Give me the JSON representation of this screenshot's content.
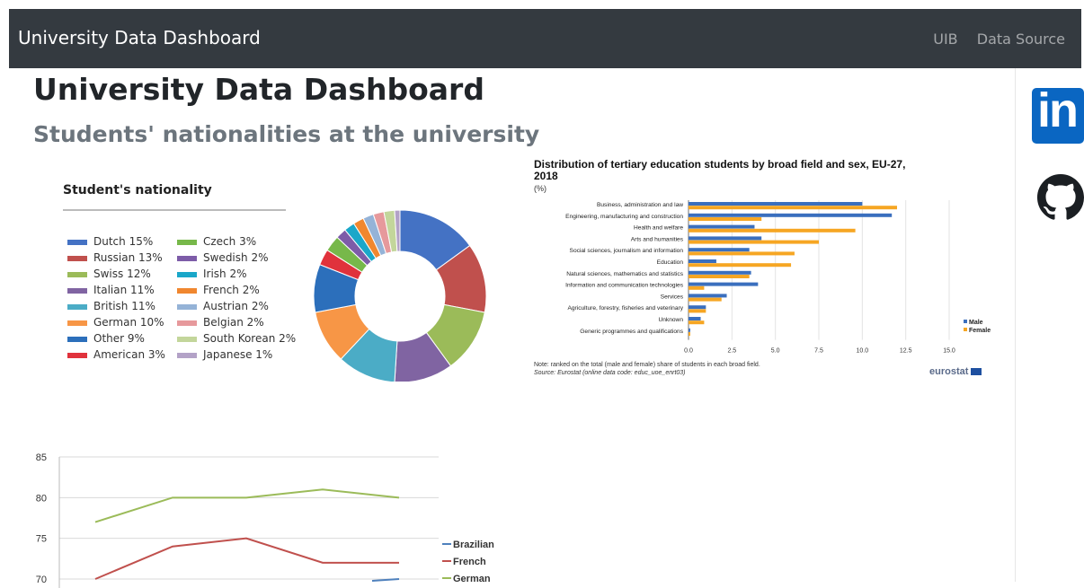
{
  "navbar": {
    "brand": "University Data Dashboard",
    "links": [
      "UIB",
      "Data Source"
    ]
  },
  "page": {
    "title": "University Data Dashboard",
    "subtitle": "Students' nationalities at the university"
  },
  "social": {
    "linkedin": "in",
    "colors": {
      "linkedin": "#0a66c2",
      "navbar": "#343a40"
    },
    "icons": [
      "linkedin-icon",
      "github-icon"
    ]
  },
  "chart_data": [
    {
      "type": "pie",
      "title": "Student's nationality",
      "donut": true,
      "slices": [
        {
          "label": "Dutch 15%",
          "value": 15,
          "color": "#4472c4"
        },
        {
          "label": "Russian 13%",
          "value": 13,
          "color": "#c0504d"
        },
        {
          "label": "Swiss 12%",
          "value": 12,
          "color": "#9bbb59"
        },
        {
          "label": "Italian 11%",
          "value": 11,
          "color": "#8064a2"
        },
        {
          "label": "British 11%",
          "value": 11,
          "color": "#4bacc6"
        },
        {
          "label": "German 10%",
          "value": 10,
          "color": "#f79646"
        },
        {
          "label": "Other 9%",
          "value": 9,
          "color": "#2c6fbb"
        },
        {
          "label": "American 3%",
          "value": 3,
          "color": "#e0323c"
        },
        {
          "label": "Czech 3%",
          "value": 3,
          "color": "#77b84a"
        },
        {
          "label": "Swedish 2%",
          "value": 2,
          "color": "#7d5ca8"
        },
        {
          "label": "Irish 2%",
          "value": 2,
          "color": "#1aa7c9"
        },
        {
          "label": "French 2%",
          "value": 2,
          "color": "#f0872f"
        },
        {
          "label": "Austrian 2%",
          "value": 2,
          "color": "#95b3d7"
        },
        {
          "label": "Belgian 2%",
          "value": 2,
          "color": "#e6999c"
        },
        {
          "label": "South Korean 2%",
          "value": 2,
          "color": "#c3d69b"
        },
        {
          "label": "Japanese 1%",
          "value": 1,
          "color": "#b3a2c7"
        }
      ]
    },
    {
      "type": "bar",
      "orientation": "horizontal",
      "title": "Distribution of tertiary education students by broad field and sex, EU-27, 2018",
      "subtitle": "(%)",
      "categories": [
        "Business, administration and law",
        "Engineering, manufacturing and construction",
        "Health and welfare",
        "Arts and humanities",
        "Social sciences, journalism and information",
        "Education",
        "Natural sciences, mathematics and statistics",
        "Information and communication technologies",
        "Services",
        "Agriculture, forestry, fisheries and veterinary",
        "Unknown",
        "Generic programmes and qualifications"
      ],
      "series": [
        {
          "name": "Male",
          "color": "#3a6fbe",
          "values": [
            10.0,
            11.7,
            3.8,
            4.2,
            3.5,
            1.6,
            3.6,
            4.0,
            2.2,
            1.0,
            0.7,
            0.1
          ]
        },
        {
          "name": "Female",
          "color": "#f6a623",
          "values": [
            12.0,
            4.2,
            9.6,
            7.5,
            6.1,
            5.9,
            3.5,
            0.9,
            1.9,
            1.0,
            0.9,
            0.1
          ]
        }
      ],
      "xlim": [
        0,
        15
      ],
      "xticks": [
        "0.0",
        "2.5",
        "5.0",
        "7.5",
        "10.0",
        "12.5",
        "15.0"
      ],
      "legend": "right",
      "note": "Note: ranked on the total (male and female) share of students in each broad field.",
      "source": "Source: Eurostat (online data code: educ_uoe_enrt03)",
      "logo": "eurostat"
    },
    {
      "type": "line",
      "yticks": [
        "85",
        "80",
        "75",
        "70"
      ],
      "ylim": [
        70,
        85
      ],
      "series": [
        {
          "name": "Brazilian",
          "color": "#4f81bd",
          "values": [
            null,
            null,
            null,
            null,
            70
          ]
        },
        {
          "name": "French",
          "color": "#c0504d",
          "values": [
            70,
            74,
            75,
            72,
            72
          ]
        },
        {
          "name": "German",
          "color": "#9bbb59",
          "values": [
            77,
            80,
            80,
            81,
            80
          ]
        }
      ],
      "legend": "right"
    }
  ]
}
